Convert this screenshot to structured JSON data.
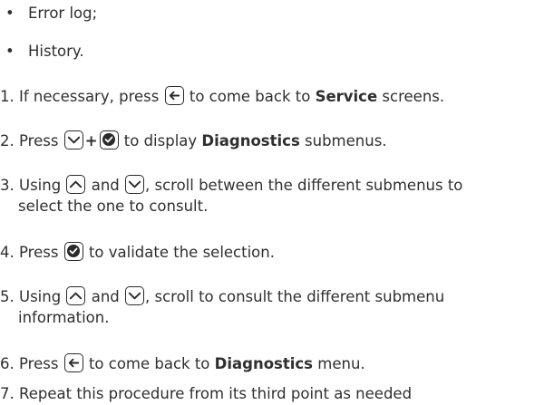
{
  "bullets": [
    "Error log;",
    "History."
  ],
  "steps": {
    "s1": {
      "num": "1.",
      "a": "If necessary, press",
      "b": "to come back to",
      "c": "Service",
      "d": "screens."
    },
    "s2": {
      "num": "2.",
      "a": "Press",
      "plus": "+",
      "b": "to display",
      "c": "Diagnostics",
      "d": "submenus."
    },
    "s3": {
      "num": "3.",
      "a": "Using",
      "b": "and",
      "c": ", scroll between the different submenus to",
      "line2": "select the one to consult."
    },
    "s4": {
      "num": "4.",
      "a": "Press",
      "b": "to validate the selection."
    },
    "s5": {
      "num": "5.",
      "a": "Using",
      "b": "and",
      "c": ", scroll to consult the different submenu",
      "line2": "information."
    },
    "s6": {
      "num": "6.",
      "a": "Press",
      "b": "to come back to",
      "c": "Diagnostics",
      "d": "menu."
    },
    "s7": {
      "num": "7.",
      "a": "Repeat this procedure from its third point as needed"
    }
  },
  "icons": {
    "back": "back-arrow-icon",
    "down": "chevron-down-icon",
    "up": "chevron-up-icon",
    "ok": "check-circle-icon"
  }
}
